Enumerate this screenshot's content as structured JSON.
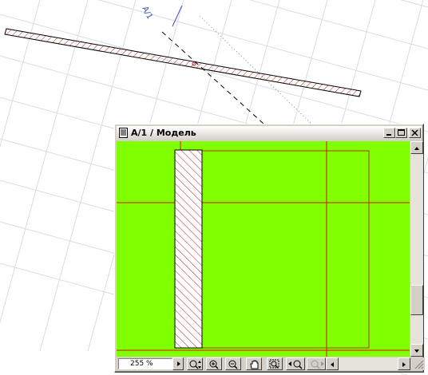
{
  "canvas": {
    "section_label": "A/1",
    "colors": {
      "grid": "#d9dde3",
      "hatch": "#cc1e1e",
      "marker": "#3a4fbf",
      "cut_line": "#000000"
    }
  },
  "window": {
    "title": "A/1 / Модель",
    "icon": "document-icon",
    "buttons": [
      "minimize-icon",
      "maximize-icon",
      "close-icon"
    ],
    "viewport": {
      "background": "#7fff00",
      "guide_color": "#e01010",
      "boundary_color": "#b23a1a"
    }
  },
  "statusbar": {
    "zoom_value": "255 %",
    "tools": [
      "expand-arrow-icon",
      "zoom-fit-icon",
      "zoom-in-icon",
      "zoom-out-icon",
      "pan-hand-icon",
      "zoom-window-icon",
      "zoom-back-icon",
      "zoom-forward-icon"
    ]
  }
}
